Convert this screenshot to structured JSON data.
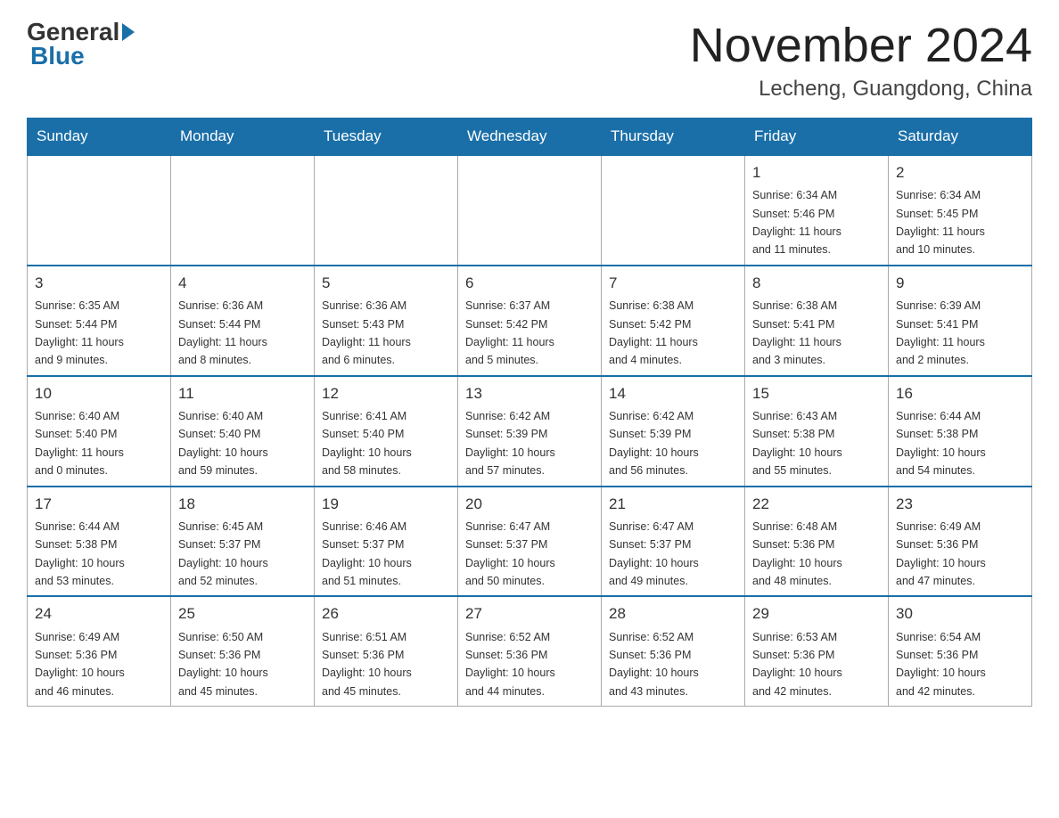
{
  "header": {
    "logo_general": "General",
    "logo_blue": "Blue",
    "month_title": "November 2024",
    "location": "Lecheng, Guangdong, China"
  },
  "days_of_week": [
    "Sunday",
    "Monday",
    "Tuesday",
    "Wednesday",
    "Thursday",
    "Friday",
    "Saturday"
  ],
  "weeks": [
    [
      {
        "day": "",
        "info": ""
      },
      {
        "day": "",
        "info": ""
      },
      {
        "day": "",
        "info": ""
      },
      {
        "day": "",
        "info": ""
      },
      {
        "day": "",
        "info": ""
      },
      {
        "day": "1",
        "info": "Sunrise: 6:34 AM\nSunset: 5:46 PM\nDaylight: 11 hours\nand 11 minutes."
      },
      {
        "day": "2",
        "info": "Sunrise: 6:34 AM\nSunset: 5:45 PM\nDaylight: 11 hours\nand 10 minutes."
      }
    ],
    [
      {
        "day": "3",
        "info": "Sunrise: 6:35 AM\nSunset: 5:44 PM\nDaylight: 11 hours\nand 9 minutes."
      },
      {
        "day": "4",
        "info": "Sunrise: 6:36 AM\nSunset: 5:44 PM\nDaylight: 11 hours\nand 8 minutes."
      },
      {
        "day": "5",
        "info": "Sunrise: 6:36 AM\nSunset: 5:43 PM\nDaylight: 11 hours\nand 6 minutes."
      },
      {
        "day": "6",
        "info": "Sunrise: 6:37 AM\nSunset: 5:42 PM\nDaylight: 11 hours\nand 5 minutes."
      },
      {
        "day": "7",
        "info": "Sunrise: 6:38 AM\nSunset: 5:42 PM\nDaylight: 11 hours\nand 4 minutes."
      },
      {
        "day": "8",
        "info": "Sunrise: 6:38 AM\nSunset: 5:41 PM\nDaylight: 11 hours\nand 3 minutes."
      },
      {
        "day": "9",
        "info": "Sunrise: 6:39 AM\nSunset: 5:41 PM\nDaylight: 11 hours\nand 2 minutes."
      }
    ],
    [
      {
        "day": "10",
        "info": "Sunrise: 6:40 AM\nSunset: 5:40 PM\nDaylight: 11 hours\nand 0 minutes."
      },
      {
        "day": "11",
        "info": "Sunrise: 6:40 AM\nSunset: 5:40 PM\nDaylight: 10 hours\nand 59 minutes."
      },
      {
        "day": "12",
        "info": "Sunrise: 6:41 AM\nSunset: 5:40 PM\nDaylight: 10 hours\nand 58 minutes."
      },
      {
        "day": "13",
        "info": "Sunrise: 6:42 AM\nSunset: 5:39 PM\nDaylight: 10 hours\nand 57 minutes."
      },
      {
        "day": "14",
        "info": "Sunrise: 6:42 AM\nSunset: 5:39 PM\nDaylight: 10 hours\nand 56 minutes."
      },
      {
        "day": "15",
        "info": "Sunrise: 6:43 AM\nSunset: 5:38 PM\nDaylight: 10 hours\nand 55 minutes."
      },
      {
        "day": "16",
        "info": "Sunrise: 6:44 AM\nSunset: 5:38 PM\nDaylight: 10 hours\nand 54 minutes."
      }
    ],
    [
      {
        "day": "17",
        "info": "Sunrise: 6:44 AM\nSunset: 5:38 PM\nDaylight: 10 hours\nand 53 minutes."
      },
      {
        "day": "18",
        "info": "Sunrise: 6:45 AM\nSunset: 5:37 PM\nDaylight: 10 hours\nand 52 minutes."
      },
      {
        "day": "19",
        "info": "Sunrise: 6:46 AM\nSunset: 5:37 PM\nDaylight: 10 hours\nand 51 minutes."
      },
      {
        "day": "20",
        "info": "Sunrise: 6:47 AM\nSunset: 5:37 PM\nDaylight: 10 hours\nand 50 minutes."
      },
      {
        "day": "21",
        "info": "Sunrise: 6:47 AM\nSunset: 5:37 PM\nDaylight: 10 hours\nand 49 minutes."
      },
      {
        "day": "22",
        "info": "Sunrise: 6:48 AM\nSunset: 5:36 PM\nDaylight: 10 hours\nand 48 minutes."
      },
      {
        "day": "23",
        "info": "Sunrise: 6:49 AM\nSunset: 5:36 PM\nDaylight: 10 hours\nand 47 minutes."
      }
    ],
    [
      {
        "day": "24",
        "info": "Sunrise: 6:49 AM\nSunset: 5:36 PM\nDaylight: 10 hours\nand 46 minutes."
      },
      {
        "day": "25",
        "info": "Sunrise: 6:50 AM\nSunset: 5:36 PM\nDaylight: 10 hours\nand 45 minutes."
      },
      {
        "day": "26",
        "info": "Sunrise: 6:51 AM\nSunset: 5:36 PM\nDaylight: 10 hours\nand 45 minutes."
      },
      {
        "day": "27",
        "info": "Sunrise: 6:52 AM\nSunset: 5:36 PM\nDaylight: 10 hours\nand 44 minutes."
      },
      {
        "day": "28",
        "info": "Sunrise: 6:52 AM\nSunset: 5:36 PM\nDaylight: 10 hours\nand 43 minutes."
      },
      {
        "day": "29",
        "info": "Sunrise: 6:53 AM\nSunset: 5:36 PM\nDaylight: 10 hours\nand 42 minutes."
      },
      {
        "day": "30",
        "info": "Sunrise: 6:54 AM\nSunset: 5:36 PM\nDaylight: 10 hours\nand 42 minutes."
      }
    ]
  ]
}
